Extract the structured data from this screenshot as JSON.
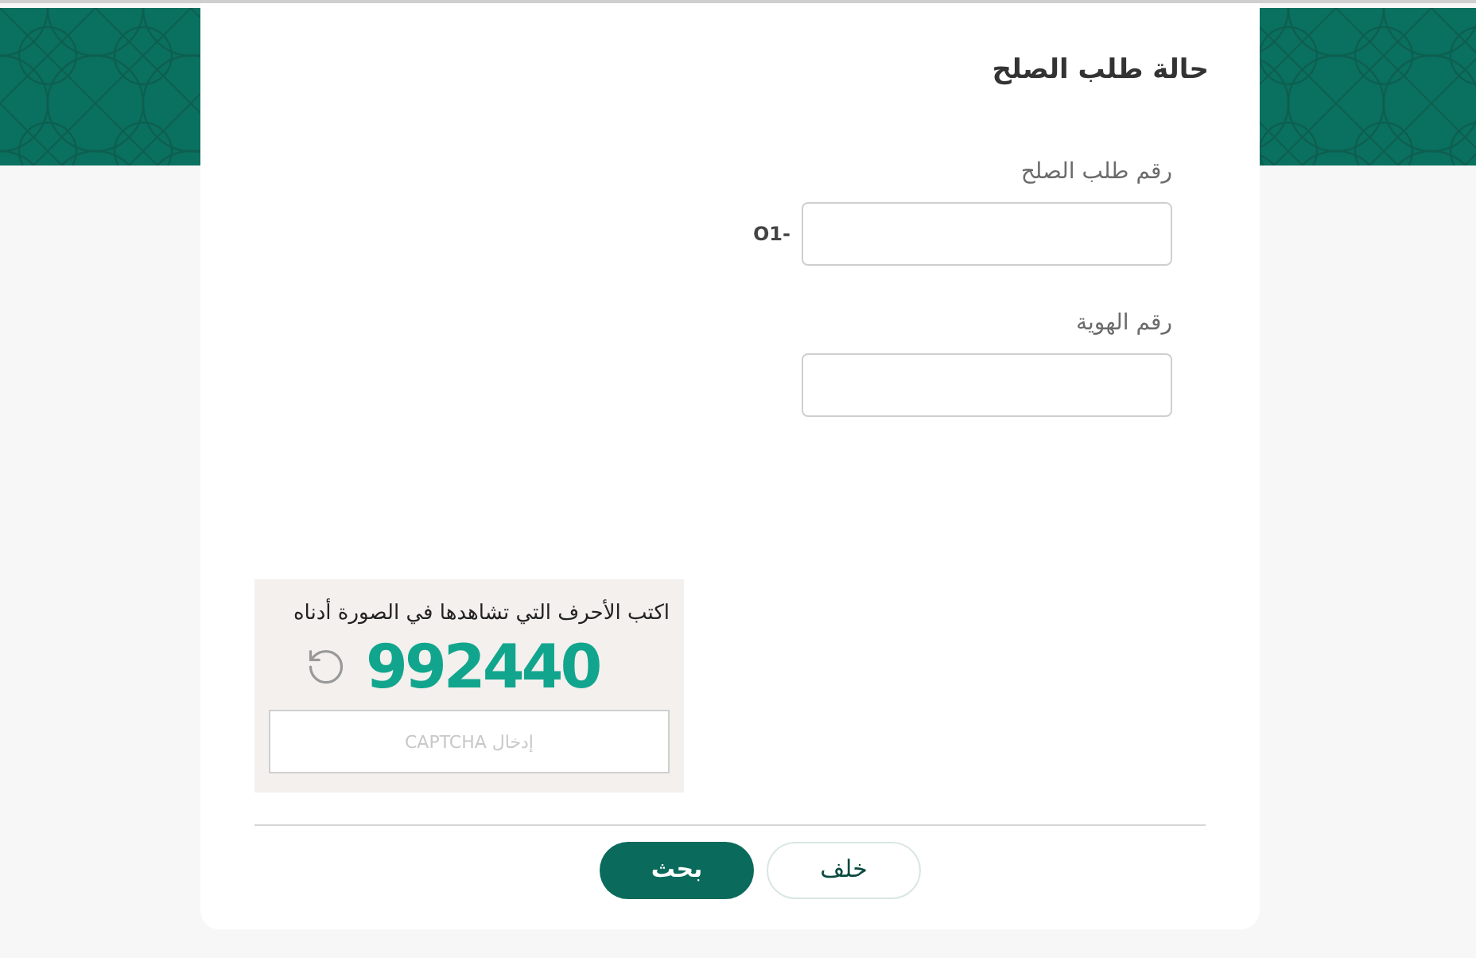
{
  "title": "حالة طلب الصلح",
  "fields": [
    {
      "label": "رقم طلب الصلح",
      "prefix": "O1-"
    },
    {
      "label": "رقم الهوية"
    }
  ],
  "captcha": {
    "instruction": "اكتب الأحرف التي تشاهدها في الصورة أدناه",
    "code": "992440",
    "placeholder": "إدخال CAPTCHA"
  },
  "buttons": [
    {
      "label": "خلف",
      "kind": "secondary"
    },
    {
      "label": "بحث",
      "kind": "primary"
    }
  ]
}
